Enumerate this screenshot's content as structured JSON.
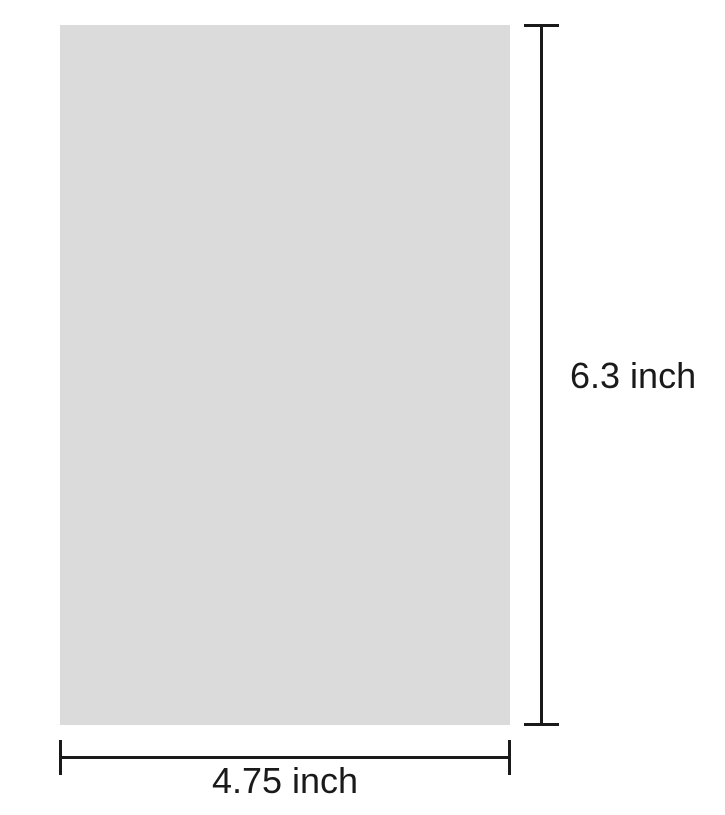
{
  "diagram": {
    "height_label": "6.3 inch",
    "width_label": "4.75 inch",
    "rectangle_color": "#dbdbdb",
    "stroke_color": "#1a1a1a"
  }
}
